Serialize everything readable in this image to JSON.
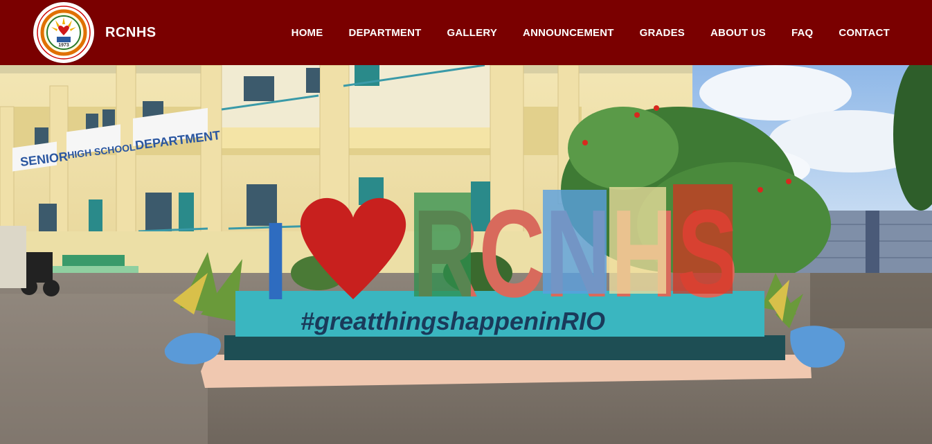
{
  "brand": {
    "name": "RCNHS",
    "logo_year": "1973",
    "logo_alt": "school-seal-logo"
  },
  "nav": {
    "items": [
      {
        "label": "HOME"
      },
      {
        "label": "DEPARTMENT"
      },
      {
        "label": "GALLERY"
      },
      {
        "label": "ANNOUNCEMENT"
      },
      {
        "label": "GRADES"
      },
      {
        "label": "ABOUT US"
      },
      {
        "label": "FAQ"
      },
      {
        "label": "CONTACT"
      }
    ]
  },
  "hero": {
    "building_signs": {
      "senior": "SENIOR",
      "high_school": "HIGH SCHOOL",
      "department": "DEPARTMENT"
    },
    "sign_letters": {
      "i": "I",
      "rcnhs": "RCNHS"
    },
    "hashtag": "#greatthingshappeninRIO"
  },
  "colors": {
    "nav_bg": "#7a0000",
    "nav_text": "#ffffff",
    "letter_i": "#2e6cc0",
    "heart": "#c8201e",
    "letter_r": "#2e8f4e",
    "letter_c": "#d86a5c",
    "letter_n": "#5aa0e0",
    "letter_h": "#f0e0a0",
    "letter_s": "#d83020",
    "sign_base": "#3ab6c0"
  }
}
